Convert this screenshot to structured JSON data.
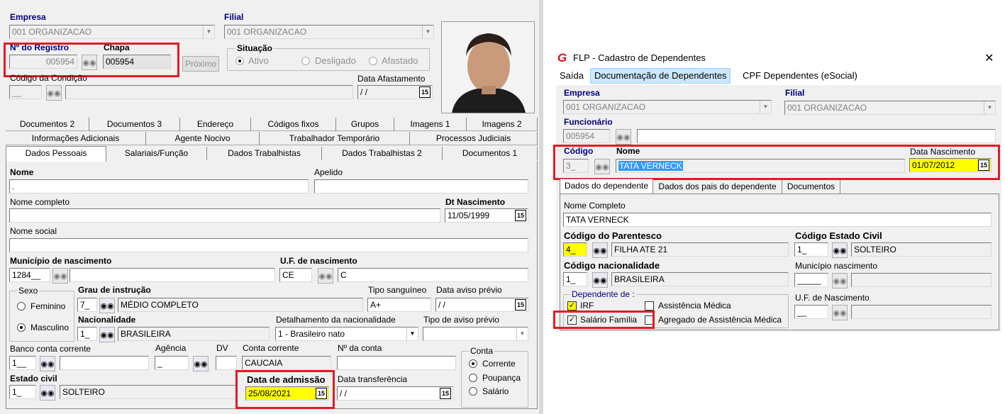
{
  "left": {
    "empresa_label": "Empresa",
    "empresa_value": "001 ORGANIZACAO",
    "filial_label": "Filial",
    "filial_value": "001 ORGANIZACAO",
    "registro_label": "Nº do Registro",
    "registro_value": "005954",
    "chapa_label": "Chapa",
    "chapa_value": "005954",
    "proximo_label": "Próximo",
    "situacao_label": "Situação",
    "sit_ativo": "Ativo",
    "sit_desligado": "Desligado",
    "sit_afastado": "Afastado",
    "condicao_label": "Código da Condição",
    "condicao_value": "__",
    "afastamento_label": "Data Afastamento",
    "afastamento_value": " / /",
    "tabs_row1": [
      "Documentos 2",
      "Documentos 3",
      "Endereço",
      "Códigos fixos",
      "Grupos",
      "Imagens 1",
      "Imagens 2"
    ],
    "tabs_row2": [
      "Informações Adicionais",
      "Agente Nocivo",
      "Trabalhador Temporário",
      "Processos Judiciais"
    ],
    "tabs_row3": [
      "Dados Pessoais",
      "Salariais/Função",
      "Dados Trabalhistas",
      "Dados Trabalhistas 2",
      "Documentos 1"
    ],
    "nome_label": "Nome",
    "nome_value": ".",
    "apelido_label": "Apelido",
    "nome_completo_label": "Nome completo",
    "dt_nasc_label": "Dt Nascimento",
    "dt_nasc_value": "11/05/1999",
    "nome_social_label": "Nome social",
    "mun_nasc_label": "Município de nascimento",
    "mun_nasc_code": "1284__",
    "uf_nasc_label": "U.F. de nascimento",
    "uf_nasc_value": "CE",
    "uf_nasc_desc": "C",
    "sexo_label": "Sexo",
    "sexo_fem": "Feminino",
    "sexo_masc": "Masculino",
    "grau_label": "Grau de instrução",
    "grau_code": "7_",
    "grau_desc": "MÉDIO COMPLETO",
    "tipo_sang_label": "Tipo sanguíneo",
    "tipo_sang_value": "A+",
    "aviso_label": "Data aviso prévio",
    "aviso_value": " / /",
    "nac_label": "Nacionalidade",
    "nac_code": "1_",
    "nac_desc": "BRASILEIRA",
    "det_nac_label": "Detalhamento da nacionalidade",
    "det_nac_value": "1 - Brasileiro nato",
    "tipo_aviso_label": "Tipo de aviso prévio",
    "banco_label": "Banco conta corrente",
    "banco_code": "1__",
    "agencia_label": "Agência",
    "agencia_code": "_",
    "dv_label": "DV",
    "conta_corr_label": "Conta corrente",
    "conta_corr_value": "CAUCAIA",
    "num_conta_label": "Nº da conta",
    "conta_label": "Conta",
    "conta_corrente": "Corrente",
    "conta_poupanca": "Poupança",
    "conta_salario": "Salário",
    "estado_civil_label": "Estado civil",
    "estado_civil_code": "1_",
    "estado_civil_desc": "SOLTEIRO",
    "admissao_label": "Data de admissão",
    "admissao_value": "25/08/2021",
    "transf_label": "Data transferência",
    "transf_value": " / /"
  },
  "right": {
    "title": "FLP - Cadastro de Dependentes",
    "close": "✕",
    "menu": [
      "Saída",
      "Documentação de Dependentes",
      "CPF Dependentes (eSocial)"
    ],
    "empresa_label": "Empresa",
    "empresa_value": "001 ORGANIZACAO",
    "filial_label": "Filial",
    "filial_value": "001 ORGANIZACAO",
    "funcionario_label": "Funcionário",
    "funcionario_value": "005954",
    "codigo_label": "Código",
    "codigo_value": "3_",
    "nome_label": "Nome",
    "nome_value": "TATA VERNECK",
    "data_nasc_label": "Data Nascimento",
    "data_nasc_value": "01/07/2012",
    "tabs": [
      "Dados do dependente",
      "Dados dos pais do dependente",
      "Documentos"
    ],
    "nome_completo_label": "Nome Completo",
    "nome_completo_value": "TATA VERNECK",
    "parentesco_label": "Código do Parentesco",
    "parentesco_code": "4_",
    "parentesco_desc": "FILHA ATE 21",
    "est_civil_label": "Código Estado Civil",
    "est_civil_code": "1_",
    "est_civil_desc": "SOLTEIRO",
    "nac_label": "Código nacionalidade",
    "nac_code": "1_",
    "nac_desc": "BRASILEIRA",
    "mun_label": "Município nascimento",
    "mun_code": "_____",
    "dep_label": "Dependente de :",
    "irf": "IRF",
    "assist": "Assistência Médica",
    "sal_fam": "Salário Família",
    "agregado": "Agregado de Assistência Médica",
    "uf_label": "U.F. de Nascimento",
    "uf_code": "__"
  },
  "colors": {
    "highlight": "#ffff00",
    "redbox": "#e01c24",
    "select": "#3399ff",
    "label_blue": "#000080"
  }
}
